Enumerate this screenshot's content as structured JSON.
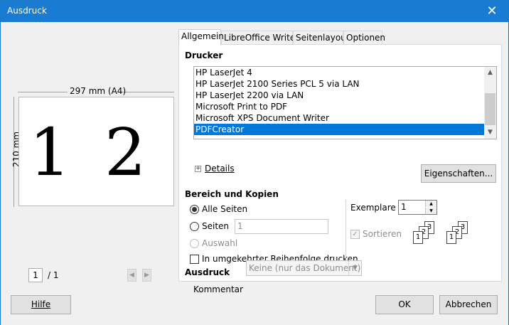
{
  "window": {
    "title": "Ausdruck",
    "close_symbol": "✕"
  },
  "preview": {
    "width_label": "297 mm (A4)",
    "height_label": "210 mm",
    "page_numbers": [
      "1",
      "2"
    ],
    "current_page": "1",
    "page_of": "/ 1",
    "prev_symbol": "◀",
    "next_symbol": "▶"
  },
  "tabs": [
    "Allgemein",
    "LibreOffice Writer",
    "Seitenlayout",
    "Optionen"
  ],
  "printer": {
    "section_title": "Drucker",
    "items": [
      "HP LaserJet 4",
      "HP LaserJet 2100 Series PCL 5 via LAN",
      "HP LaserJet 2200 via LAN",
      "Microsoft Print to PDF",
      "Microsoft XPS Document Writer",
      "PDFCreator"
    ],
    "selected": "PDFCreator",
    "details_label": "Details",
    "properties_button": "Eigenschaften..."
  },
  "range": {
    "section_title": "Bereich und Kopien",
    "all_pages": "Alle Seiten",
    "pages": "Seiten",
    "pages_value": "1",
    "selection": "Auswahl",
    "reverse": "In umgekehrter Reihenfolge drucken",
    "copies_label": "Exemplare",
    "copies_value": "1",
    "collate_label": "Sortieren"
  },
  "output": {
    "section_title": "Ausdruck",
    "comment_label": "Kommentar",
    "comment_value": "Keine (nur das Dokument)"
  },
  "buttons": {
    "help": "Hilfe",
    "ok": "OK",
    "cancel": "Abbrechen"
  },
  "colors": {
    "titlebar": "#1a7bd2",
    "selection": "#0078d7"
  }
}
